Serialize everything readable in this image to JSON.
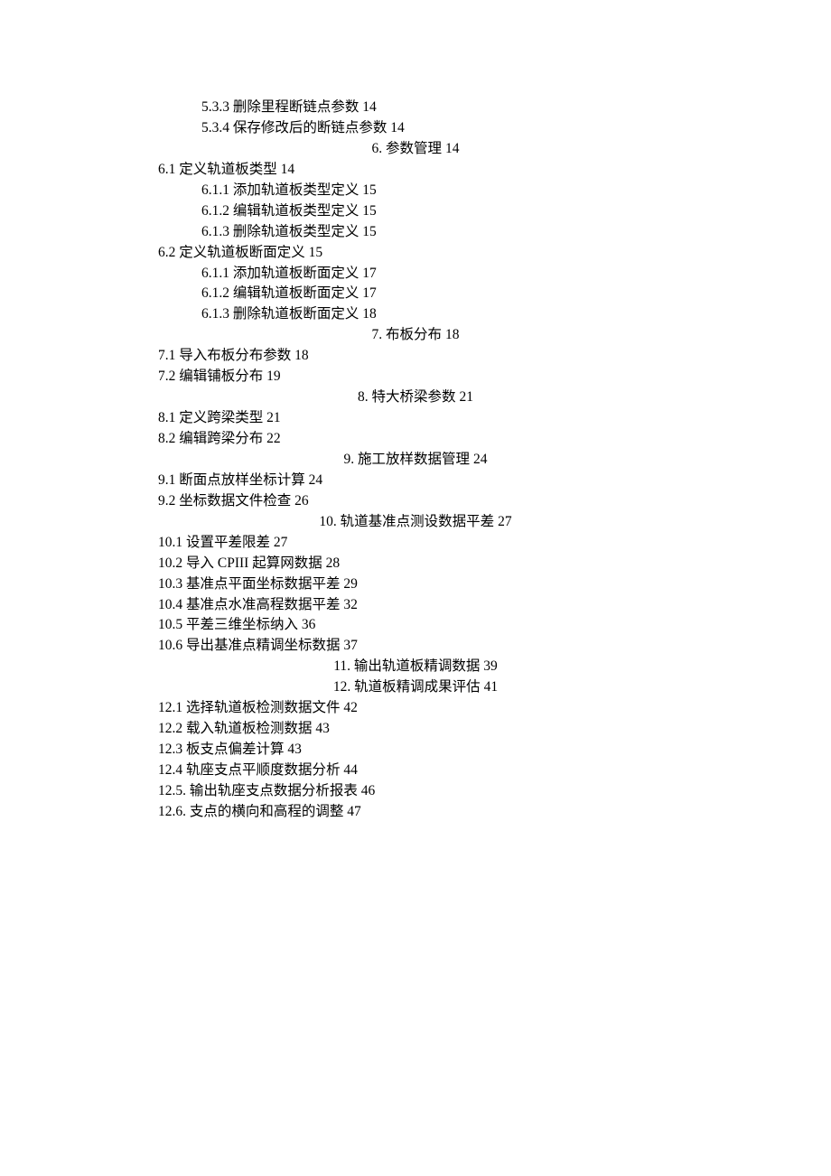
{
  "toc": [
    {
      "level": "lvl2",
      "num": "5.3.3",
      "title": "删除里程断链点参数",
      "page": "14"
    },
    {
      "level": "lvl2",
      "num": "5.3.4",
      "title": "保存修改后的断链点参数",
      "page": "14"
    },
    {
      "level": "center",
      "num": "6.",
      "title": "参数管理",
      "page": "14"
    },
    {
      "level": "lvl1",
      "num": "6.1",
      "title": "定义轨道板类型",
      "page": "14"
    },
    {
      "level": "lvl2",
      "num": "6.1.1",
      "title": "添加轨道板类型定义",
      "page": "15"
    },
    {
      "level": "lvl2",
      "num": "6.1.2",
      "title": "编辑轨道板类型定义",
      "page": "15"
    },
    {
      "level": "lvl2",
      "num": "6.1.3",
      "title": "删除轨道板类型定义",
      "page": "15"
    },
    {
      "level": "lvl1",
      "num": "6.2",
      "title": "定义轨道板断面定义",
      "page": "15"
    },
    {
      "level": "lvl2",
      "num": "6.1.1",
      "title": "添加轨道板断面定义",
      "page": "17"
    },
    {
      "level": "lvl2",
      "num": "6.1.2",
      "title": "编辑轨道板断面定义",
      "page": "17"
    },
    {
      "level": "lvl2",
      "num": "6.1.3",
      "title": "删除轨道板断面定义",
      "page": "18"
    },
    {
      "level": "center",
      "num": "7.",
      "title": "布板分布",
      "page": "18"
    },
    {
      "level": "lvl1",
      "num": "7.1",
      "title": "导入布板分布参数",
      "page": "18"
    },
    {
      "level": "lvl1",
      "num": "7.2",
      "title": "编辑铺板分布",
      "page": "19"
    },
    {
      "level": "center",
      "num": "8.",
      "title": "特大桥梁参数",
      "page": "21"
    },
    {
      "level": "lvl1",
      "num": "8.1",
      "title": "定义跨梁类型",
      "page": "21"
    },
    {
      "level": "lvl1",
      "num": "8.2",
      "title": "编辑跨梁分布",
      "page": "22"
    },
    {
      "level": "center",
      "num": "9.",
      "title": "施工放样数据管理",
      "page": "24"
    },
    {
      "level": "lvl1",
      "num": "9.1",
      "title": "断面点放样坐标计算",
      "page": "24"
    },
    {
      "level": "lvl1",
      "num": "9.2",
      "title": "坐标数据文件检查",
      "page": "26"
    },
    {
      "level": "center",
      "num": "10.",
      "title": "轨道基准点测设数据平差",
      "page": "27"
    },
    {
      "level": "lvl1",
      "num": "10.1",
      "title": "设置平差限差",
      "page": "27"
    },
    {
      "level": "lvl1",
      "num": "10.2",
      "title": "导入 CPIII 起算网数据",
      "page": "28"
    },
    {
      "level": "lvl1",
      "num": "10.3",
      "title": "基准点平面坐标数据平差",
      "page": "29"
    },
    {
      "level": "lvl1",
      "num": "10.4",
      "title": "基准点水准高程数据平差",
      "page": "32"
    },
    {
      "level": "lvl1",
      "num": "10.5",
      "title": "平差三维坐标纳入",
      "page": "36"
    },
    {
      "level": "lvl1",
      "num": "10.6",
      "title": "导出基准点精调坐标数据",
      "page": "37"
    },
    {
      "level": "center",
      "num": "11.",
      "title": "输出轨道板精调数据",
      "page": "39"
    },
    {
      "level": "center",
      "num": "12.",
      "title": "轨道板精调成果评估",
      "page": "41"
    },
    {
      "level": "lvl1",
      "num": "12.1",
      "title": "选择轨道板检测数据文件",
      "page": "42"
    },
    {
      "level": "lvl1",
      "num": "12.2",
      "title": "载入轨道板检测数据",
      "page": "43"
    },
    {
      "level": "lvl1",
      "num": "12.3",
      "title": "板支点偏差计算",
      "page": "43"
    },
    {
      "level": "lvl1",
      "num": "12.4",
      "title": "轨座支点平顺度数据分析",
      "page": "44"
    },
    {
      "level": "lvl1",
      "num": "12.5.",
      "title": "输出轨座支点数据分析报表",
      "page": "46"
    },
    {
      "level": "lvl1",
      "num": "12.6.",
      "title": "支点的横向和高程的调整",
      "page": "47"
    }
  ]
}
